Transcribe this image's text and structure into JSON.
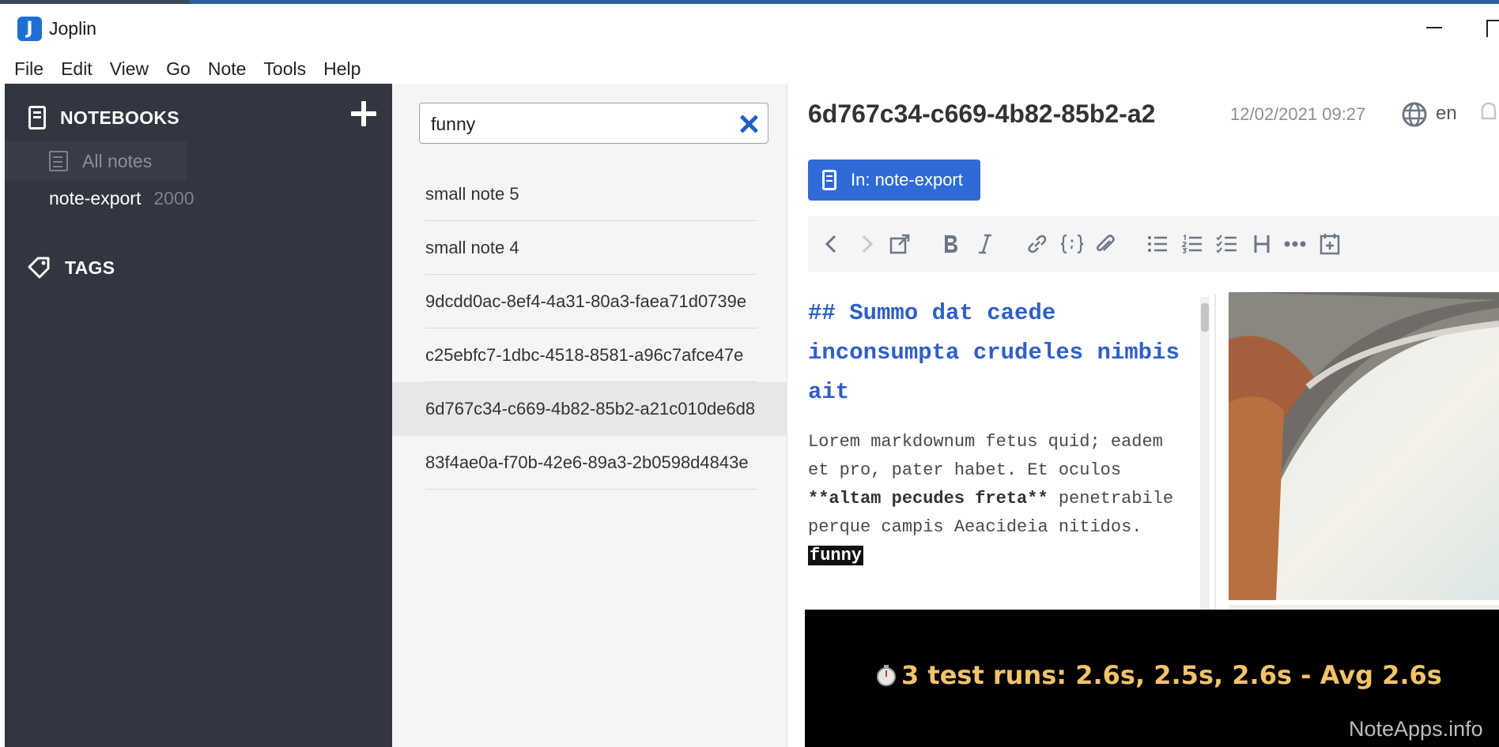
{
  "window": {
    "title": "Joplin",
    "icon_letter": "J"
  },
  "menu": [
    "File",
    "Edit",
    "View",
    "Go",
    "Note",
    "Tools",
    "Help"
  ],
  "sidebar": {
    "notebooks_header": "NOTEBOOKS",
    "all_notes_label": "All notes",
    "notebooks": [
      {
        "name": "note-export",
        "count": "2000"
      }
    ],
    "tags_header": "TAGS"
  },
  "notelist": {
    "search_value": "funny",
    "items": [
      {
        "title": "small note 5",
        "selected": false
      },
      {
        "title": "small note 4",
        "selected": false
      },
      {
        "title": "9dcdd0ac-8ef4-4a31-80a3-faea71d0739e",
        "selected": false
      },
      {
        "title": "c25ebfc7-1dbc-4518-8581-a96c7afce47e",
        "selected": false
      },
      {
        "title": "6d767c34-c669-4b82-85b2-a21c010de6d8",
        "selected": true
      },
      {
        "title": "83f4ae0a-f70b-42e6-89a3-2b0598d4843e",
        "selected": false
      }
    ]
  },
  "editor": {
    "title": "6d767c34-c669-4b82-85b2-a2",
    "date": "12/02/2021 09:27",
    "language": "en",
    "notebook_badge": "In: note-export",
    "markdown": {
      "heading": "## Summo dat caede inconsumpta crudeles nimbis ait",
      "body_part1": "Lorem markdownum fetus quid; eadem et pro, pater habet. Et oculos ",
      "body_bold": "**altam pecudes freta**",
      "body_part2": " penetrabile perque campis Aeacideia nitidos. ",
      "body_highlight": "funny"
    }
  },
  "overlay": {
    "text": "3 test runs:  2.6s, 2.5s, 2.6s - Avg 2.6s",
    "color": "#f2c36b"
  },
  "watermark": "NoteApps.info",
  "colors": {
    "sidebar_bg": "#313640",
    "accent": "#2e6bd6",
    "heading": "#2f5fc6"
  }
}
